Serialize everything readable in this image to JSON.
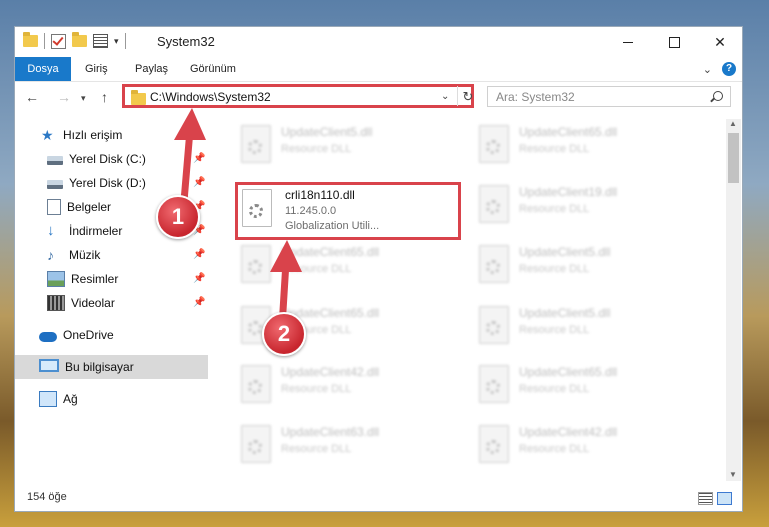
{
  "window": {
    "title": "System32",
    "controls": {
      "minimize_icon": "minimize-icon",
      "maximize_icon": "maximize-icon",
      "close_symbol": "✕"
    }
  },
  "ribbon": {
    "tabs": [
      {
        "label": "Dosya"
      },
      {
        "label": "Giriş"
      },
      {
        "label": "Paylaş"
      },
      {
        "label": "Görünüm"
      }
    ],
    "help": "?"
  },
  "address": {
    "path": "C:\\Windows\\System32"
  },
  "search": {
    "placeholder": "Ara: System32"
  },
  "sidebar": {
    "items": [
      {
        "label": "Hızlı erişim",
        "icon": "star-icon"
      },
      {
        "label": "Yerel Disk (C:)",
        "icon": "disk-icon",
        "pinned": true
      },
      {
        "label": "Yerel Disk (D:)",
        "icon": "disk-icon",
        "pinned": true
      },
      {
        "label": "Belgeler",
        "icon": "document-icon",
        "pinned": true
      },
      {
        "label": "İndirmeler",
        "icon": "download-icon",
        "pinned": true
      },
      {
        "label": "Müzik",
        "icon": "music-icon",
        "pinned": true
      },
      {
        "label": "Resimler",
        "icon": "pictures-icon",
        "pinned": true
      },
      {
        "label": "Videolar",
        "icon": "videos-icon",
        "pinned": true
      },
      {
        "label": "OneDrive",
        "icon": "cloud-icon"
      },
      {
        "label": "Bu bilgisayar",
        "icon": "computer-icon",
        "selected": true
      },
      {
        "label": "Ağ",
        "icon": "network-icon"
      }
    ]
  },
  "files": {
    "left": [
      {
        "name": "UpdateClient5.dll",
        "desc": "Resource DLL"
      },
      {
        "name": "UpdateClient65.dll",
        "desc": "Resource DLL"
      },
      {
        "name": "UpdateClient65.dll",
        "desc": "Resource DLL"
      },
      {
        "name": "UpdateClient42.dll",
        "desc": "Resource DLL"
      },
      {
        "name": "UpdateClient63.dll",
        "desc": "Resource DLL"
      }
    ],
    "right": [
      {
        "name": "UpdateClient65.dll",
        "desc": "Resource DLL"
      },
      {
        "name": "UpdateClient19.dll",
        "desc": "Resource DLL"
      },
      {
        "name": "UpdateClient5.dll",
        "desc": "Resource DLL"
      },
      {
        "name": "UpdateClient5.dll",
        "desc": "Resource DLL"
      },
      {
        "name": "UpdateClient65.dll",
        "desc": "Resource DLL"
      },
      {
        "name": "UpdateClient42.dll",
        "desc": "Resource DLL"
      }
    ],
    "highlighted": {
      "name": "crli18n110.dll",
      "version": "11.245.0.0",
      "desc": "Globalization Utili..."
    }
  },
  "status": {
    "count": "154 öğe"
  },
  "annotations": {
    "step1": "1",
    "step2": "2",
    "color": "#d9434b"
  }
}
